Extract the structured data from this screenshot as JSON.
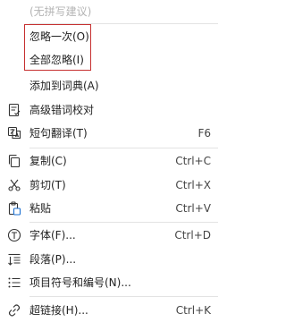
{
  "menu": {
    "items": [
      {
        "label": "(无拼写建议)",
        "shortcut": ""
      },
      {
        "label": "忽略一次(O)",
        "shortcut": ""
      },
      {
        "label": "全部忽略(I)",
        "shortcut": ""
      },
      {
        "label": "添加到词典(A)",
        "shortcut": ""
      },
      {
        "label": "高级错词校对",
        "shortcut": "",
        "icon": "proofread-icon"
      },
      {
        "label": "短句翻译(T)",
        "shortcut": "F6",
        "icon": "translate-icon"
      },
      {
        "label": "复制(C)",
        "shortcut": "Ctrl+C",
        "icon": "copy-icon"
      },
      {
        "label": "剪切(T)",
        "shortcut": "Ctrl+X",
        "icon": "scissors-icon"
      },
      {
        "label": "粘贴",
        "shortcut": "Ctrl+V",
        "icon": "paste-icon"
      },
      {
        "label": "字体(F)...",
        "shortcut": "Ctrl+D",
        "icon": "font-icon"
      },
      {
        "label": "段落(P)...",
        "shortcut": "",
        "icon": "paragraph-icon"
      },
      {
        "label": "项目符号和编号(N)...",
        "shortcut": "",
        "icon": "bullets-icon"
      },
      {
        "label": "超链接(H)...",
        "shortcut": "Ctrl+K",
        "icon": "link-icon"
      }
    ]
  },
  "colors": {
    "highlight_border": "#c62f2f",
    "divider": "#e3e3e3",
    "disabled_text": "#b4b4b4"
  }
}
